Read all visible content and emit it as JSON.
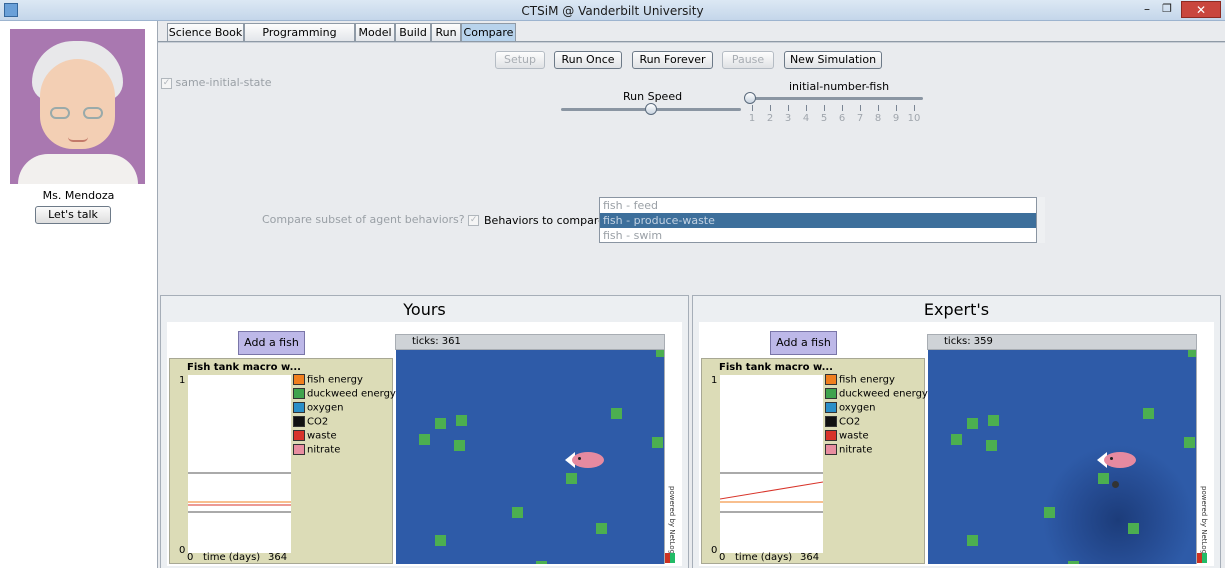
{
  "window": {
    "title": "CTSiM @ Vanderbilt University"
  },
  "teacher": {
    "name": "Ms. Mendoza",
    "talk_button": "Let's talk"
  },
  "tabs": [
    "Science Book",
    "Programming Guide",
    "Model",
    "Build",
    "Run",
    "Compare"
  ],
  "active_tab": "Compare",
  "controls": {
    "setup": "Setup",
    "run_once": "Run Once",
    "run_forever": "Run Forever",
    "pause": "Pause",
    "new_simulation": "New Simulation",
    "same_initial_state": "same-initial-state",
    "run_speed_label": "Run Speed",
    "run_speed_value": 0.5,
    "initial_fish_label": "initial-number-fish",
    "initial_fish_ticks": [
      "1",
      "2",
      "3",
      "4",
      "5",
      "6",
      "7",
      "8",
      "9",
      "10"
    ],
    "initial_fish_value": 1
  },
  "compare": {
    "subset_label": "Compare subset of agent behaviors?",
    "behaviors_label": "Behaviors to compare:",
    "behaviors": [
      "fish - feed",
      "fish - produce-waste",
      "fish - swim"
    ],
    "selected_behavior": "fish - produce-waste"
  },
  "panels": {
    "yours": {
      "title": "Yours",
      "add_fish": "Add a fish",
      "ticks": "ticks: 361"
    },
    "expert": {
      "title": "Expert's",
      "add_fish": "Add a fish",
      "ticks": "ticks: 359"
    }
  },
  "plot": {
    "title": "Fish tank macro w...",
    "y_max": "1",
    "y_min": "0",
    "x_min": "0",
    "x_label": "time (days)",
    "x_max": "364",
    "legend": [
      {
        "label": "fish energy",
        "color": "#f07f1e"
      },
      {
        "label": "duckweed energy",
        "color": "#3fa34d"
      },
      {
        "label": "oxygen",
        "color": "#2b8fc8"
      },
      {
        "label": "CO2",
        "color": "#111111"
      },
      {
        "label": "waste",
        "color": "#d8342a"
      },
      {
        "label": "nitrate",
        "color": "#e88ea0"
      }
    ]
  },
  "world": {
    "powered_by": "powered by NetLogo",
    "water_color": "#2e5ba8",
    "duckweed_color": "#4caf50"
  }
}
